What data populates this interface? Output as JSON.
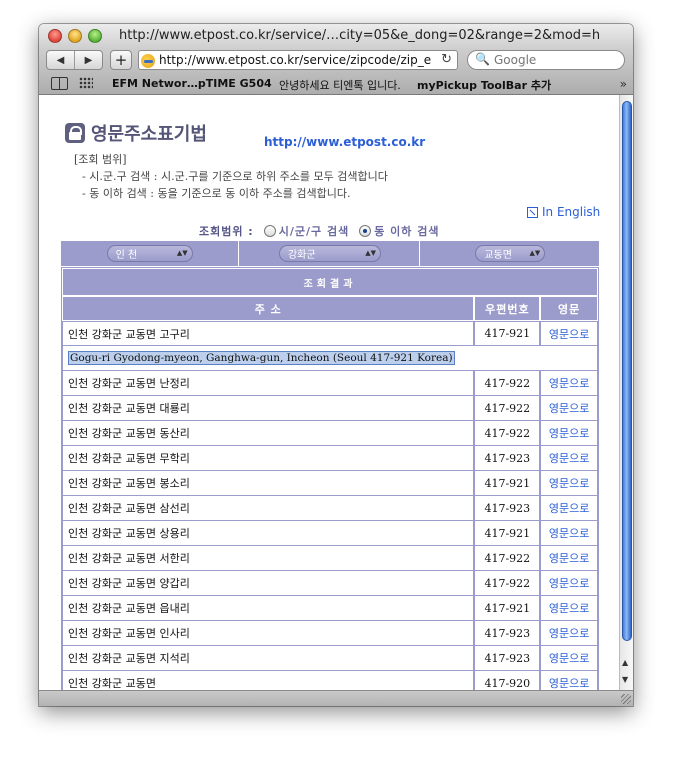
{
  "window": {
    "title": "http://www.etpost.co.kr/service/…city=05&e_dong=02&range=2&mod=h"
  },
  "toolbar": {
    "back_label": "◀",
    "forward_label": "▶",
    "add_label": "+",
    "url": "http://www.etpost.co.kr/service/zipcode/zip_e",
    "search_placeholder": "Google"
  },
  "bookmarks": [
    "EFM Networ…pTIME G504",
    "안녕하세요 티엔톡 입니다.",
    "myPickup ToolBar 추가"
  ],
  "page": {
    "title": "영문주소표기법",
    "site_link": "http://www.etpost.co.kr",
    "range_heading": "[조회 범위]",
    "range_line1": "- 시.군.구 검색 : 시.군.구를 기준으로 하위 주소를 모두 검색합니다",
    "range_line2": "- 동 이하 검색 : 동을 기준으로 동 이하 주소를 검색합니다.",
    "english_link": "In English",
    "search_range_label": "조회범위 :",
    "option_city": "시/군/구 검색",
    "option_dong": "동 이하 검색",
    "selected_option": "dong",
    "select_city": "인 천",
    "select_district": "강화군",
    "select_dong": "교동면",
    "results_title": "조회결과",
    "col_address": "주 소",
    "col_zip": "우편번호",
    "col_english": "영문"
  },
  "rows": [
    {
      "address": "인천 강화군 교동면 고구리",
      "zip": "417-921",
      "link": "영문으로"
    },
    {
      "address": "인천 강화군 교동면 난정리",
      "zip": "417-922",
      "link": "영문으로"
    },
    {
      "address": "인천 강화군 교동면 대룡리",
      "zip": "417-922",
      "link": "영문으로"
    },
    {
      "address": "인천 강화군 교동면 동산리",
      "zip": "417-922",
      "link": "영문으로"
    },
    {
      "address": "인천 강화군 교동면 무학리",
      "zip": "417-923",
      "link": "영문으로"
    },
    {
      "address": "인천 강화군 교동면 봉소리",
      "zip": "417-921",
      "link": "영문으로"
    },
    {
      "address": "인천 강화군 교동면 삼선리",
      "zip": "417-923",
      "link": "영문으로"
    },
    {
      "address": "인천 강화군 교동면 상용리",
      "zip": "417-921",
      "link": "영문으로"
    },
    {
      "address": "인천 강화군 교동면 서한리",
      "zip": "417-922",
      "link": "영문으로"
    },
    {
      "address": "인천 강화군 교동면 양갑리",
      "zip": "417-922",
      "link": "영문으로"
    },
    {
      "address": "인천 강화군 교동면 읍내리",
      "zip": "417-921",
      "link": "영문으로"
    },
    {
      "address": "인천 강화군 교동면 인사리",
      "zip": "417-923",
      "link": "영문으로"
    },
    {
      "address": "인천 강화군 교동면 지석리",
      "zip": "417-923",
      "link": "영문으로"
    },
    {
      "address": "인천 강화군 교동면",
      "zip": "417-920",
      "link": "영문으로"
    }
  ],
  "english_result": "Gogu-ri Gyodong-myeon, Ganghwa-gun, Incheon (Seoul 417-921 Korea)"
}
